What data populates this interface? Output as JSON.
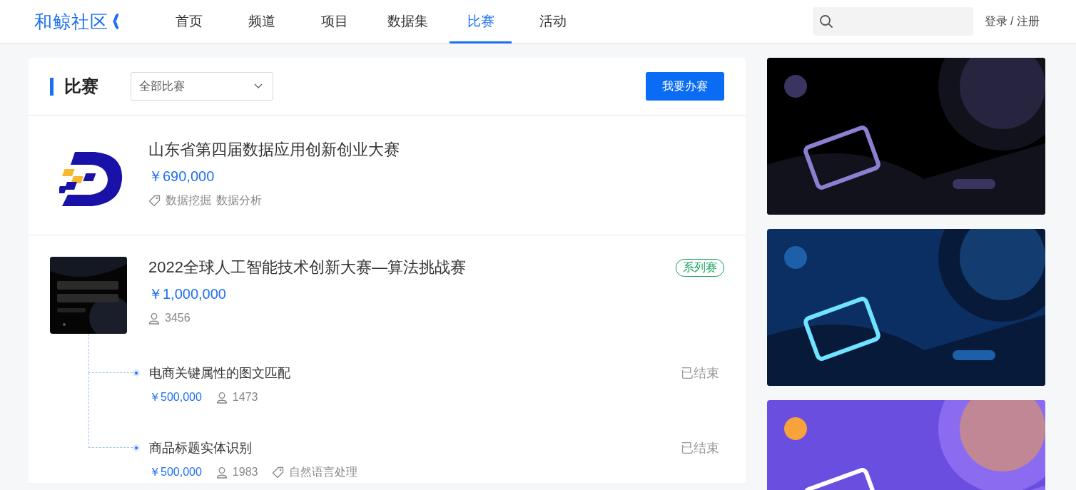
{
  "nav": {
    "logo": "和鲸社区",
    "items": [
      {
        "label": "首页",
        "selected": false
      },
      {
        "label": "频道",
        "selected": false
      },
      {
        "label": "项目",
        "selected": false
      },
      {
        "label": "数据集",
        "selected": false
      },
      {
        "label": "比赛",
        "selected": true
      },
      {
        "label": "活动",
        "selected": false
      }
    ],
    "login": "登录 / 注册"
  },
  "main": {
    "title": "比赛",
    "filter": {
      "value": "全部比赛"
    },
    "create_button": "我要办赛",
    "competitions": [
      {
        "kind": "logo",
        "title": "山东省第四届数据应用创新创业大赛",
        "prize": "￥690,000",
        "tags": [
          "数据挖掘",
          "数据分析"
        ]
      },
      {
        "kind": "picture",
        "title": "2022全球人工智能技术创新大赛—算法挑战赛",
        "prize": "￥1,000,000",
        "participants": "3456",
        "badge": "系列赛",
        "children": [
          {
            "title": "电商关键属性的图文匹配",
            "status": "已结束",
            "prize": "￥500,000",
            "participants": "1473"
          },
          {
            "title": "商品标题实体识别",
            "status": "已结束",
            "prize": "￥500,000",
            "participants": "1983",
            "tags": [
              "自然语言处理"
            ]
          }
        ]
      }
    ]
  }
}
